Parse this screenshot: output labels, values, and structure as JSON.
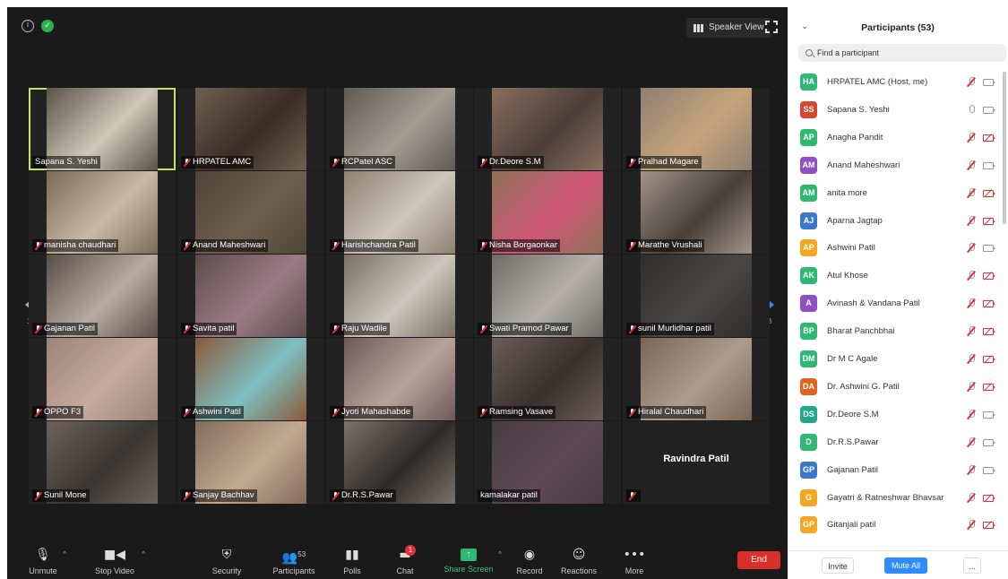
{
  "meeting": {
    "speaker_view_label": "Speaker View",
    "page_indicator": "1/3"
  },
  "tiles": [
    {
      "name": "Sapana S. Yeshi",
      "muted": false,
      "active": true,
      "bg": "#5a5346",
      "fg": "#cfc7b8"
    },
    {
      "name": "HRPATEL AMC",
      "muted": true,
      "active": false,
      "bg": "#6e6050",
      "fg": "#3a2c24"
    },
    {
      "name": "RCPatel ASC",
      "muted": true,
      "active": false,
      "bg": "#5f5a52",
      "fg": "#a39d92"
    },
    {
      "name": "Dr.Deore S.M",
      "muted": true,
      "active": false,
      "bg": "#8a6e5e",
      "fg": "#4b3e38"
    },
    {
      "name": "Pralhad Magare",
      "muted": true,
      "active": false,
      "bg": "#8e7f74",
      "fg": "#c6a47a"
    },
    {
      "name": "manisha chaudhari",
      "muted": true,
      "active": false,
      "bg": "#7a6a54",
      "fg": "#c9b9a4"
    },
    {
      "name": "Anand Maheshwari",
      "muted": true,
      "active": false,
      "bg": "#4e4438",
      "fg": "#6e604f"
    },
    {
      "name": "Harishchandra Patil",
      "muted": true,
      "active": false,
      "bg": "#8d8173",
      "fg": "#cfc5b9"
    },
    {
      "name": "Nisha Borgaonkar",
      "muted": true,
      "active": false,
      "bg": "#8e7156",
      "fg": "#d15778"
    },
    {
      "name": "Marathe Vrushali",
      "muted": true,
      "active": false,
      "bg": "#a0938a",
      "fg": "#4a4038"
    },
    {
      "name": "Gajanan Patil",
      "muted": true,
      "active": false,
      "bg": "#5a4f47",
      "fg": "#b7aaa0"
    },
    {
      "name": "Savita patil",
      "muted": true,
      "active": false,
      "bg": "#5e4a4a",
      "fg": "#9b7b86"
    },
    {
      "name": "Raju Wadile",
      "muted": true,
      "active": false,
      "bg": "#7a7063",
      "fg": "#cdc6bc"
    },
    {
      "name": "Swati Pramod Pawar",
      "muted": true,
      "active": false,
      "bg": "#6e6b68",
      "fg": "#b5b0aa"
    },
    {
      "name": "sunil Murlidhar patil",
      "muted": true,
      "active": false,
      "bg": "#2e2d2b",
      "fg": "#4a4744"
    },
    {
      "name": "OPPO F3",
      "muted": true,
      "active": false,
      "bg": "#9b8478",
      "fg": "#c6aa9c"
    },
    {
      "name": "Ashwini Patil",
      "muted": true,
      "active": false,
      "bg": "#8a5a3a",
      "fg": "#7ec0c2"
    },
    {
      "name": "Jyoti Mahashabde",
      "muted": true,
      "active": false,
      "bg": "#6e5a55",
      "fg": "#b8a29c"
    },
    {
      "name": "Ramsing Vasave",
      "muted": true,
      "active": false,
      "bg": "#6b5c58",
      "fg": "#3a302e"
    },
    {
      "name": "Hiralal Chaudhari",
      "muted": true,
      "active": false,
      "bg": "#7b6656",
      "fg": "#ad9c8e"
    },
    {
      "name": "Sunil Mone",
      "muted": true,
      "active": false,
      "bg": "#6b625a",
      "fg": "#3a3633"
    },
    {
      "name": "Sanjay Bachhav",
      "muted": true,
      "active": false,
      "bg": "#866c5a",
      "fg": "#c0a991"
    },
    {
      "name": "Dr.R.S.Pawar",
      "muted": true,
      "active": false,
      "bg": "#7c726a",
      "fg": "#2c2a28"
    },
    {
      "name": "kamalakar patil",
      "muted": false,
      "active": false,
      "bg": "#4a3c42",
      "fg": "#5e4a54"
    },
    {
      "name": "",
      "muted": true,
      "active": false,
      "bg": "#222222",
      "fg": "#222222",
      "big_name": "Ravindra Patil"
    }
  ],
  "toolbar": {
    "unmute": "Unmute",
    "stop_video": "Stop Video",
    "security": "Security",
    "participants": "Participants",
    "participants_count": "53",
    "polls": "Polls",
    "chat": "Chat",
    "chat_badge": "1",
    "share_screen": "Share Screen",
    "record": "Record",
    "reactions": "Reactions",
    "more": "More",
    "end": "End"
  },
  "panel": {
    "title": "Participants (53)",
    "search_placeholder": "Find a participant",
    "participants": [
      {
        "initials": "HA",
        "name": "HRPATEL AMC (Host, me)",
        "color": "#2eb872",
        "mic_muted": true,
        "cam_off": false
      },
      {
        "initials": "SS",
        "name": "Sapana S. Yeshi",
        "color": "#d9452f",
        "mic_muted": false,
        "cam_off": false
      },
      {
        "initials": "AP",
        "name": "Anagha Pandit",
        "color": "#2eb872",
        "mic_muted": true,
        "cam_off": true
      },
      {
        "initials": "AM",
        "name": "Anand Maheshwari",
        "color": "#8e4fc7",
        "mic_muted": true,
        "cam_off": false
      },
      {
        "initials": "AM",
        "name": "anita more",
        "color": "#2eb872",
        "mic_muted": true,
        "cam_off": true
      },
      {
        "initials": "AJ",
        "name": "Aparna Jagtap",
        "color": "#3a79c9",
        "mic_muted": true,
        "cam_off": true
      },
      {
        "initials": "AP",
        "name": "Ashwini Patil",
        "color": "#f5a623",
        "mic_muted": true,
        "cam_off": false
      },
      {
        "initials": "AK",
        "name": "Atul Khose",
        "color": "#2eb872",
        "mic_muted": true,
        "cam_off": true
      },
      {
        "initials": "A",
        "name": "Avinash & Vandana  Patil",
        "color": "#8e4fc7",
        "mic_muted": true,
        "cam_off": true
      },
      {
        "initials": "BP",
        "name": "Bharat Panchbhai",
        "color": "#2eb872",
        "mic_muted": true,
        "cam_off": true
      },
      {
        "initials": "DM",
        "name": "Dr M C Agale",
        "color": "#2eb872",
        "mic_muted": true,
        "cam_off": true
      },
      {
        "initials": "DA",
        "name": "Dr. Ashwini G. Patil",
        "color": "#e0631f",
        "mic_muted": true,
        "cam_off": true
      },
      {
        "initials": "DS",
        "name": "Dr.Deore S.M",
        "color": "#1fa98a",
        "mic_muted": true,
        "cam_off": false
      },
      {
        "initials": "D",
        "name": "Dr.R.S.Pawar",
        "color": "#2eb872",
        "mic_muted": true,
        "cam_off": false
      },
      {
        "initials": "GP",
        "name": "Gajanan Patil",
        "color": "#3a79c9",
        "mic_muted": true,
        "cam_off": false
      },
      {
        "initials": "G",
        "name": "Gayatri & Ratneshwar Bhavsar",
        "color": "#f5a623",
        "mic_muted": true,
        "cam_off": true
      },
      {
        "initials": "GP",
        "name": "Gitanjali patil",
        "color": "#f5a623",
        "mic_muted": true,
        "cam_off": true
      }
    ],
    "invite": "Invite",
    "mute_all": "Mute All",
    "more_dots": "..."
  }
}
